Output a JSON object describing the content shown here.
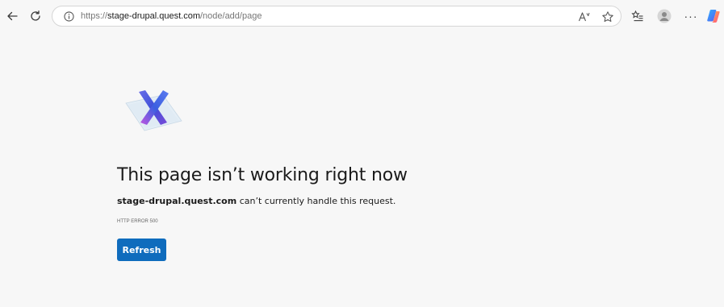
{
  "browser": {
    "url": {
      "scheme": "https://",
      "host": "stage-drupal.quest.com",
      "path": "/node/add/page"
    },
    "read_aloud_label": "Àʾ",
    "more_label": "···",
    "icons": {
      "back": "back-arrow-icon",
      "reload": "reload-icon",
      "info": "info-icon",
      "read_aloud": "read-aloud-icon",
      "favorite": "star-icon",
      "collections": "collections-icon",
      "profile": "profile-avatar-icon",
      "more": "more-icon",
      "copilot": "copilot-icon"
    }
  },
  "error": {
    "title": "This page isn’t working right now",
    "host": "stage-drupal.quest.com",
    "message": " can’t currently handle this request.",
    "code": "HTTP ERROR 500",
    "refresh_label": "Refresh"
  },
  "colors": {
    "accent": "#0f6cbd",
    "background": "#f7f7f7"
  }
}
